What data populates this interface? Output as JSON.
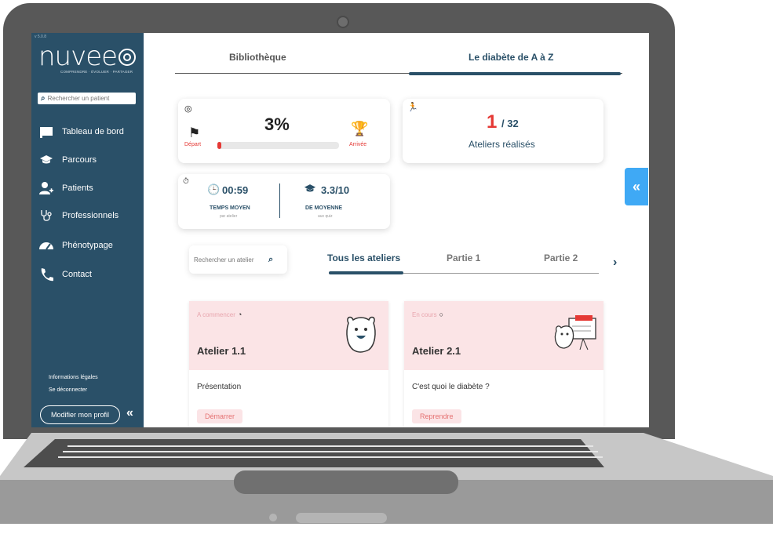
{
  "sidebar": {
    "version": "v 5.0.8",
    "logo_text": "nuvee",
    "tagline": "COMPRENDRE · ÉVOLUER · PARTAGER",
    "search_placeholder": "Rechercher un patient",
    "items": [
      {
        "label": "Tableau de bord",
        "icon": "dashboard-icon"
      },
      {
        "label": "Parcours",
        "icon": "graduation-cap-icon"
      },
      {
        "label": "Patients",
        "icon": "add-user-icon"
      },
      {
        "label": "Professionnels",
        "icon": "stethoscope-icon"
      },
      {
        "label": "Phénotypage",
        "icon": "gauge-icon"
      },
      {
        "label": "Contact",
        "icon": "phone-icon"
      }
    ],
    "legal_label": "Informations légales",
    "logout_label": "Se déconnecter",
    "profile_button": "Modifier mon profil",
    "collapse_label": "«"
  },
  "top_tabs": {
    "tabs": [
      "Bibliothèque",
      "Le diabète de A à Z"
    ],
    "active_index": 1
  },
  "progress": {
    "percent_label": "3%",
    "percent_value": 3,
    "start_label": "Départ",
    "end_label": "Arrivée"
  },
  "workshops_done": {
    "done": "1",
    "total": "/ 32",
    "label": "Ateliers réalisés"
  },
  "stats": {
    "avg_time": "00:59",
    "avg_time_label": "TEMPS MOYEN",
    "avg_time_sub": "par atelier",
    "avg_score": "3.3/10",
    "avg_score_label": "DE MOYENNE",
    "avg_score_sub": "aux quiz"
  },
  "atelier_search": {
    "placeholder": "Rechercher un atelier"
  },
  "sub_tabs": {
    "tabs": [
      "Tous les ateliers",
      "Partie 1",
      "Partie 2"
    ],
    "active_index": 0
  },
  "ateliers": [
    {
      "status": "A commencer",
      "title": "Atelier 1.1",
      "description": "Présentation",
      "button": "Démarrer"
    },
    {
      "status": "En cours",
      "title": "Atelier 2.1",
      "description": "C'est quoi le diabète ?",
      "button": "Reprendre"
    }
  ],
  "expand_label": "«",
  "colors": {
    "sidebar_bg": "#2a5068",
    "accent_red": "#e53935",
    "card_pink": "#fbe4e6",
    "expand_blue": "#3fa9f5"
  }
}
